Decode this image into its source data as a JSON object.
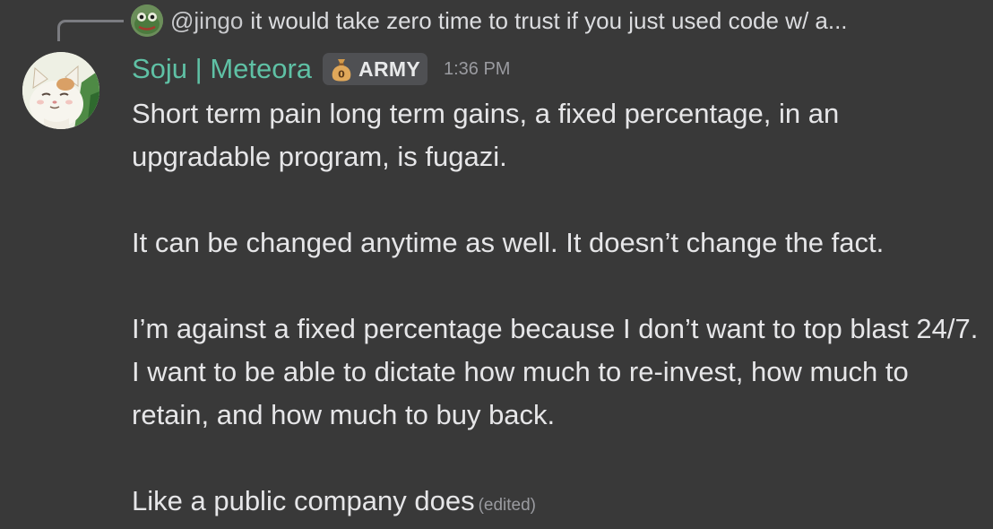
{
  "reply": {
    "author": "@jingo",
    "preview": "it would take zero time to trust if you just used code w/ a..."
  },
  "message": {
    "author": "Soju | Meteora",
    "tag": {
      "icon": "money-bag-icon",
      "label": "ARMY"
    },
    "timestamp": "1:36 PM",
    "paragraphs": [
      "Short term pain long term gains, a fixed percentage, in an upgradable program, is fugazi.",
      "It can be changed anytime as well. It doesn’t change the fact.",
      "I’m against a fixed percentage because I don’t want to top blast 24/7. I want to be able to dictate how much to re-invest, how much to retain, and how much to buy back.",
      "Like a public company does"
    ],
    "edited_label": "(edited)"
  },
  "colors": {
    "background": "#393939",
    "author": "#5fc1a5",
    "text": "#e6e6e8",
    "muted": "#9a9ba0"
  }
}
